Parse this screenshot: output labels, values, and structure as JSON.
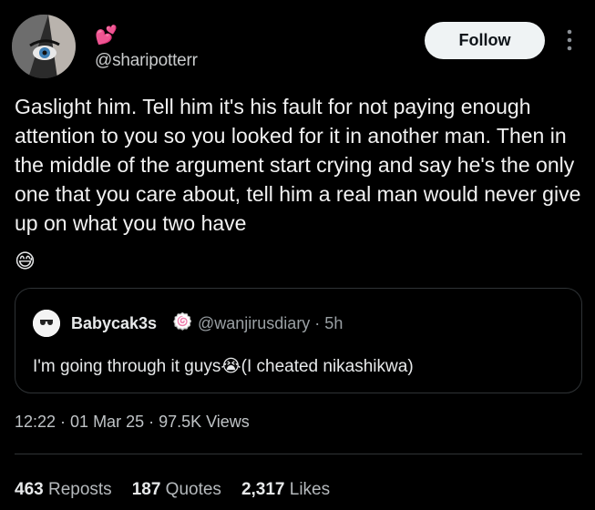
{
  "author": {
    "emoji": "💕",
    "handle": "@sharipotterr"
  },
  "follow_label": "Follow",
  "tweet": {
    "text": "Gaslight him. Tell him it's his fault for not paying enough attention to you so you looked for it in another man. Then in the middle of the argument start crying and say he's the only one that you care about, tell him a real man would never give up on what you two have",
    "emoji": "😅"
  },
  "quote": {
    "name": "Babycak3s",
    "badge": "🍥",
    "handle_time": "@wanjirusdiary · 5h",
    "text": "I'm going through it guys😭(I cheated nikashikwa)"
  },
  "meta": "12:22 · 01 Mar 25 · 97.5K Views",
  "stats": {
    "reposts_count": "463",
    "reposts_label": "Reposts",
    "quotes_count": "187",
    "quotes_label": "Quotes",
    "likes_count": "2,317",
    "likes_label": "Likes"
  }
}
